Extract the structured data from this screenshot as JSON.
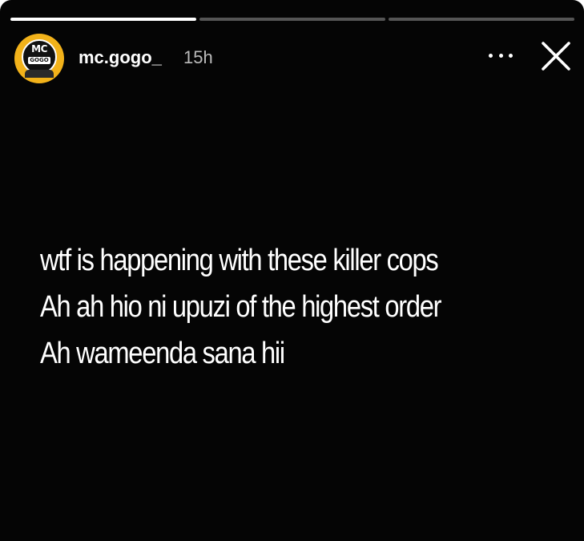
{
  "story": {
    "progress": [
      {
        "fill": 1.0
      },
      {
        "fill": 0.0
      },
      {
        "fill": 0.0
      }
    ],
    "author": {
      "username": "mc.gogo_",
      "avatar_logo": "MC",
      "avatar_sub": "GOGO"
    },
    "time": "15h",
    "icons": {
      "more": "more-dots-icon",
      "close": "close-icon"
    },
    "text_lines": [
      "wtf is happening with these killer cops",
      "Ah ah hio ni upuzi of the highest order",
      "Ah wameenda sana hii"
    ]
  }
}
